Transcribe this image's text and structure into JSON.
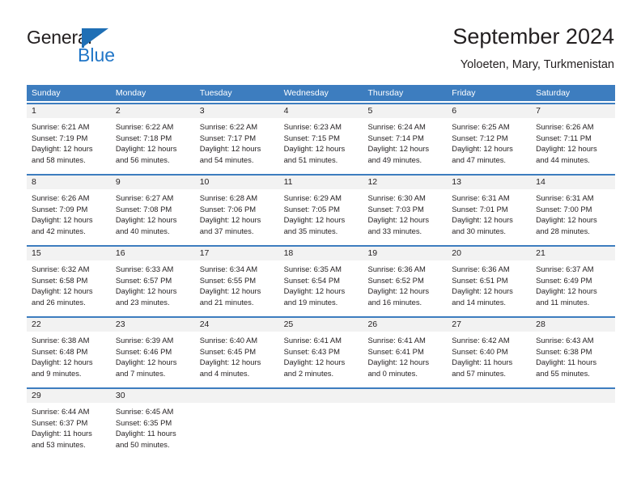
{
  "brand": {
    "name_top": "General",
    "name_bottom": "Blue",
    "flag_color": "#1f6fb5",
    "blue_color": "#2176c7"
  },
  "header": {
    "title": "September 2024",
    "subtitle": "Yoloeten, Mary, Turkmenistan"
  },
  "theme": {
    "header_blue": "#3d7dbf",
    "daynum_gray": "#f2f2f2",
    "text": "#231f20"
  },
  "weekdays": [
    "Sunday",
    "Monday",
    "Tuesday",
    "Wednesday",
    "Thursday",
    "Friday",
    "Saturday"
  ],
  "weeks": [
    [
      {
        "day": "1",
        "sunrise": "Sunrise: 6:21 AM",
        "sunset": "Sunset: 7:19 PM",
        "daylight1": "Daylight: 12 hours",
        "daylight2": "and 58 minutes."
      },
      {
        "day": "2",
        "sunrise": "Sunrise: 6:22 AM",
        "sunset": "Sunset: 7:18 PM",
        "daylight1": "Daylight: 12 hours",
        "daylight2": "and 56 minutes."
      },
      {
        "day": "3",
        "sunrise": "Sunrise: 6:22 AM",
        "sunset": "Sunset: 7:17 PM",
        "daylight1": "Daylight: 12 hours",
        "daylight2": "and 54 minutes."
      },
      {
        "day": "4",
        "sunrise": "Sunrise: 6:23 AM",
        "sunset": "Sunset: 7:15 PM",
        "daylight1": "Daylight: 12 hours",
        "daylight2": "and 51 minutes."
      },
      {
        "day": "5",
        "sunrise": "Sunrise: 6:24 AM",
        "sunset": "Sunset: 7:14 PM",
        "daylight1": "Daylight: 12 hours",
        "daylight2": "and 49 minutes."
      },
      {
        "day": "6",
        "sunrise": "Sunrise: 6:25 AM",
        "sunset": "Sunset: 7:12 PM",
        "daylight1": "Daylight: 12 hours",
        "daylight2": "and 47 minutes."
      },
      {
        "day": "7",
        "sunrise": "Sunrise: 6:26 AM",
        "sunset": "Sunset: 7:11 PM",
        "daylight1": "Daylight: 12 hours",
        "daylight2": "and 44 minutes."
      }
    ],
    [
      {
        "day": "8",
        "sunrise": "Sunrise: 6:26 AM",
        "sunset": "Sunset: 7:09 PM",
        "daylight1": "Daylight: 12 hours",
        "daylight2": "and 42 minutes."
      },
      {
        "day": "9",
        "sunrise": "Sunrise: 6:27 AM",
        "sunset": "Sunset: 7:08 PM",
        "daylight1": "Daylight: 12 hours",
        "daylight2": "and 40 minutes."
      },
      {
        "day": "10",
        "sunrise": "Sunrise: 6:28 AM",
        "sunset": "Sunset: 7:06 PM",
        "daylight1": "Daylight: 12 hours",
        "daylight2": "and 37 minutes."
      },
      {
        "day": "11",
        "sunrise": "Sunrise: 6:29 AM",
        "sunset": "Sunset: 7:05 PM",
        "daylight1": "Daylight: 12 hours",
        "daylight2": "and 35 minutes."
      },
      {
        "day": "12",
        "sunrise": "Sunrise: 6:30 AM",
        "sunset": "Sunset: 7:03 PM",
        "daylight1": "Daylight: 12 hours",
        "daylight2": "and 33 minutes."
      },
      {
        "day": "13",
        "sunrise": "Sunrise: 6:31 AM",
        "sunset": "Sunset: 7:01 PM",
        "daylight1": "Daylight: 12 hours",
        "daylight2": "and 30 minutes."
      },
      {
        "day": "14",
        "sunrise": "Sunrise: 6:31 AM",
        "sunset": "Sunset: 7:00 PM",
        "daylight1": "Daylight: 12 hours",
        "daylight2": "and 28 minutes."
      }
    ],
    [
      {
        "day": "15",
        "sunrise": "Sunrise: 6:32 AM",
        "sunset": "Sunset: 6:58 PM",
        "daylight1": "Daylight: 12 hours",
        "daylight2": "and 26 minutes."
      },
      {
        "day": "16",
        "sunrise": "Sunrise: 6:33 AM",
        "sunset": "Sunset: 6:57 PM",
        "daylight1": "Daylight: 12 hours",
        "daylight2": "and 23 minutes."
      },
      {
        "day": "17",
        "sunrise": "Sunrise: 6:34 AM",
        "sunset": "Sunset: 6:55 PM",
        "daylight1": "Daylight: 12 hours",
        "daylight2": "and 21 minutes."
      },
      {
        "day": "18",
        "sunrise": "Sunrise: 6:35 AM",
        "sunset": "Sunset: 6:54 PM",
        "daylight1": "Daylight: 12 hours",
        "daylight2": "and 19 minutes."
      },
      {
        "day": "19",
        "sunrise": "Sunrise: 6:36 AM",
        "sunset": "Sunset: 6:52 PM",
        "daylight1": "Daylight: 12 hours",
        "daylight2": "and 16 minutes."
      },
      {
        "day": "20",
        "sunrise": "Sunrise: 6:36 AM",
        "sunset": "Sunset: 6:51 PM",
        "daylight1": "Daylight: 12 hours",
        "daylight2": "and 14 minutes."
      },
      {
        "day": "21",
        "sunrise": "Sunrise: 6:37 AM",
        "sunset": "Sunset: 6:49 PM",
        "daylight1": "Daylight: 12 hours",
        "daylight2": "and 11 minutes."
      }
    ],
    [
      {
        "day": "22",
        "sunrise": "Sunrise: 6:38 AM",
        "sunset": "Sunset: 6:48 PM",
        "daylight1": "Daylight: 12 hours",
        "daylight2": "and 9 minutes."
      },
      {
        "day": "23",
        "sunrise": "Sunrise: 6:39 AM",
        "sunset": "Sunset: 6:46 PM",
        "daylight1": "Daylight: 12 hours",
        "daylight2": "and 7 minutes."
      },
      {
        "day": "24",
        "sunrise": "Sunrise: 6:40 AM",
        "sunset": "Sunset: 6:45 PM",
        "daylight1": "Daylight: 12 hours",
        "daylight2": "and 4 minutes."
      },
      {
        "day": "25",
        "sunrise": "Sunrise: 6:41 AM",
        "sunset": "Sunset: 6:43 PM",
        "daylight1": "Daylight: 12 hours",
        "daylight2": "and 2 minutes."
      },
      {
        "day": "26",
        "sunrise": "Sunrise: 6:41 AM",
        "sunset": "Sunset: 6:41 PM",
        "daylight1": "Daylight: 12 hours",
        "daylight2": "and 0 minutes."
      },
      {
        "day": "27",
        "sunrise": "Sunrise: 6:42 AM",
        "sunset": "Sunset: 6:40 PM",
        "daylight1": "Daylight: 11 hours",
        "daylight2": "and 57 minutes."
      },
      {
        "day": "28",
        "sunrise": "Sunrise: 6:43 AM",
        "sunset": "Sunset: 6:38 PM",
        "daylight1": "Daylight: 11 hours",
        "daylight2": "and 55 minutes."
      }
    ],
    [
      {
        "day": "29",
        "sunrise": "Sunrise: 6:44 AM",
        "sunset": "Sunset: 6:37 PM",
        "daylight1": "Daylight: 11 hours",
        "daylight2": "and 53 minutes."
      },
      {
        "day": "30",
        "sunrise": "Sunrise: 6:45 AM",
        "sunset": "Sunset: 6:35 PM",
        "daylight1": "Daylight: 11 hours",
        "daylight2": "and 50 minutes."
      },
      {
        "day": "",
        "sunrise": "",
        "sunset": "",
        "daylight1": "",
        "daylight2": ""
      },
      {
        "day": "",
        "sunrise": "",
        "sunset": "",
        "daylight1": "",
        "daylight2": ""
      },
      {
        "day": "",
        "sunrise": "",
        "sunset": "",
        "daylight1": "",
        "daylight2": ""
      },
      {
        "day": "",
        "sunrise": "",
        "sunset": "",
        "daylight1": "",
        "daylight2": ""
      },
      {
        "day": "",
        "sunrise": "",
        "sunset": "",
        "daylight1": "",
        "daylight2": ""
      }
    ]
  ]
}
